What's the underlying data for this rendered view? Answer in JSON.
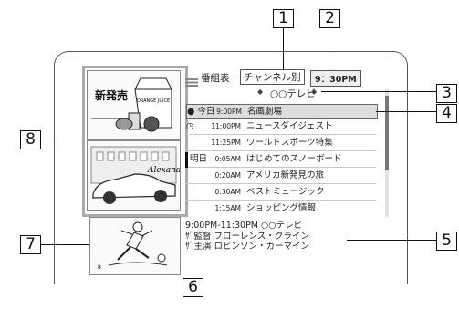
{
  "header": {
    "program_guide_label": "番組表",
    "sort_mode": "チャンネル別",
    "current_time": "9：30PM",
    "channel_name": "○○テレビ"
  },
  "thumbnails": [
    {
      "label": "新発売",
      "sub_text": "ORANGE JUICE"
    },
    {
      "label": "",
      "sub_text": "Alexandra"
    },
    {
      "label": "",
      "sub_text": "8"
    }
  ],
  "programs": [
    {
      "date": "今日",
      "time": "9:00PM",
      "title": "名画劇場",
      "selected": true
    },
    {
      "date": "",
      "time": "11:00PM",
      "title": "ニュースダイジェスト",
      "selected": false
    },
    {
      "date": "",
      "time": "11:25PM",
      "title": "ワールドスポーツ特集",
      "selected": false
    },
    {
      "date": "明日",
      "time": "0:05AM",
      "title": "はじめてのスノーボード",
      "selected": false
    },
    {
      "date": "",
      "time": "0:20AM",
      "title": "アメリカ新発見の旅",
      "selected": false
    },
    {
      "date": "",
      "time": "0:30AM",
      "title": "ベストミュージック",
      "selected": false
    },
    {
      "date": "",
      "time": "1:15AM",
      "title": "ショッピング情報",
      "selected": false
    }
  ],
  "detail": {
    "line1": "9:00PM-11:30PM ○○テレビ",
    "line2": "ｻﾞ監督 フローレンス・クライン",
    "line3": "ｻﾞ主演 ロビンソン・カーマイン"
  },
  "callouts": [
    "1",
    "2",
    "3",
    "4",
    "5",
    "6",
    "7",
    "8"
  ],
  "colors": {
    "frame": "#555555",
    "selected_row": "#dddddd",
    "thumb_border": "#aaaaaa"
  },
  "icons": {
    "today_marker": "filled-circle-icon",
    "clock": "clock-icon",
    "chan_prev": "arrow-left-icon",
    "chan_next": "arrow-right-icon",
    "guide": "list-icon"
  }
}
